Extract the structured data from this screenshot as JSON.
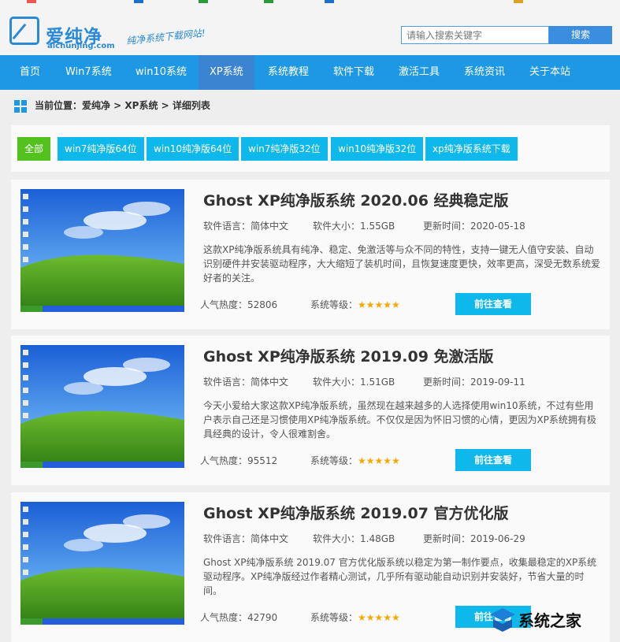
{
  "header": {
    "logo_cn": "爱纯净",
    "logo_en": "aichunjing.com",
    "slogan": "纯净系统下载网站!",
    "search_placeholder": "请输入搜索关键字",
    "search_button": "搜索"
  },
  "nav": [
    "首页",
    "Win7系统",
    "win10系统",
    "XP系统",
    "系统教程",
    "软件下载",
    "激活工具",
    "系统资讯",
    "关于本站"
  ],
  "nav_active": "XP系统",
  "breadcrumb": "当前位置：爱纯净 > XP系统 > 详细列表",
  "filters": [
    "全部",
    "win7纯净版64位",
    "win10纯净版64位",
    "win7纯净版32位",
    "win10纯净版32位",
    "xp纯净版系统下载"
  ],
  "items": [
    {
      "title": "Ghost XP纯净版系统 2020.06 经典稳定版",
      "language": "软件语言：简体中文",
      "size": "软件大小：1.55GB",
      "updated": "更新时间：2020-05-18",
      "description": "这款XP纯净版系统具有纯净、稳定、免激活等与众不同的特性，支持一键无人值守安装、自动识别硬件并安装驱动程序，大大缩短了装机时间，且恢复速度更快，效率更高，深受无数系统爱好者的关注。",
      "popularity": "人气热度：52806",
      "grade_label": "系统等级：",
      "stars": "★★★★★",
      "button": "前往查看"
    },
    {
      "title": "Ghost XP纯净版系统 2019.09 免激活版",
      "language": "软件语言：简体中文",
      "size": "软件大小：1.51GB",
      "updated": "更新时间：2019-09-11",
      "description": "今天小爱给大家这款XP纯净版系统，虽然现在越来越多的人选择使用win10系统，不过有些用户表示自己还是习惯使用XP纯净版系统。不仅仅是因为怀旧习惯的心情，更因为XP系统拥有极具经典的设计，令人很难割舍。",
      "popularity": "人气热度：95512",
      "grade_label": "系统等级：",
      "stars": "★★★★★",
      "button": "前往查看"
    },
    {
      "title": "Ghost XP纯净版系统 2019.07 官方优化版",
      "language": "软件语言：简体中文",
      "size": "软件大小：1.48GB",
      "updated": "更新时间：2019-06-29",
      "description": "Ghost XP纯净版系统 2019.07 官方优化版系统以稳定为第一制作要点，收集最稳定的XP系统驱动程序。XP纯净版经过作者精心测试，几乎所有驱动能自动识别并安装好，节省大量的时间。",
      "popularity": "人气热度：42790",
      "grade_label": "系统等级：",
      "stars": "★★★★★",
      "button": "前往查看"
    }
  ],
  "watermark": "系统之家",
  "colors": {
    "nav": "#1e98e4",
    "tag": "#0fb8ea",
    "tag_all": "#53c11e",
    "star": "#f5a800"
  }
}
